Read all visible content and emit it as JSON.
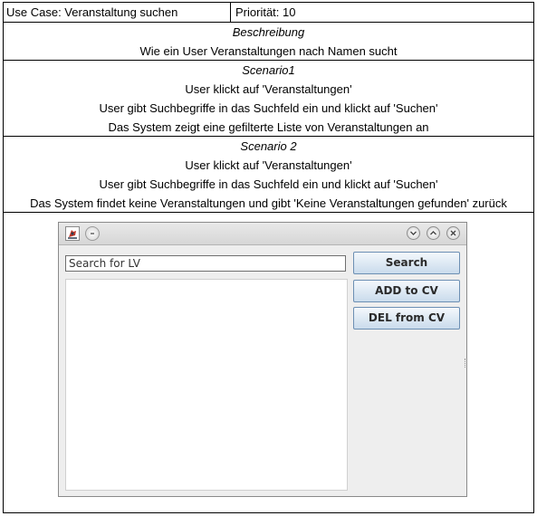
{
  "header": {
    "use_case": "Use Case: Veranstaltung suchen",
    "priority": "Priorität: 10"
  },
  "description": {
    "title": "Beschreibung",
    "text": "Wie ein User Veranstaltungen nach Namen sucht"
  },
  "scenario1": {
    "title": "Scenario1",
    "steps": [
      "User klickt auf 'Veranstaltungen'",
      "User gibt Suchbegriffe in das Suchfeld ein und klickt auf 'Suchen'",
      "Das System zeigt eine gefilterte Liste von Veranstaltungen an"
    ]
  },
  "scenario2": {
    "title": "Scenario 2",
    "steps": [
      "User klickt auf 'Veranstaltungen'",
      "User gibt Suchbegriffe in das Suchfeld ein und klickt auf 'Suchen'",
      "Das System findet keine Veranstaltungen und gibt 'Keine Veranstaltungen gefunden' zurück"
    ]
  },
  "app_window": {
    "icons": {
      "app": "java-app-icon",
      "menu": "window-menu-icon",
      "minimize": "chevron-down-icon",
      "maximize": "chevron-up-icon",
      "close": "close-icon"
    },
    "search_value": "Search for LV",
    "buttons": {
      "search": "Search",
      "add": "ADD to CV",
      "del": "DEL from CV"
    },
    "colors": {
      "button_border": "#6c8fb3",
      "button_fill": "#c9dbec",
      "window_bg": "#eeeeee"
    }
  }
}
